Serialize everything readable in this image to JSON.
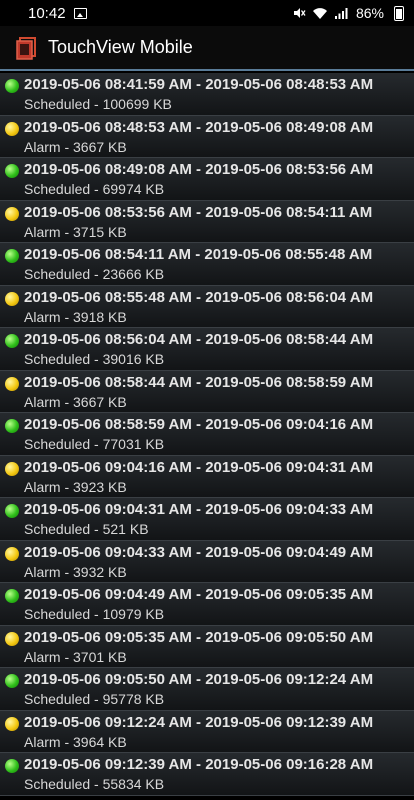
{
  "status_bar": {
    "time": "10:42",
    "battery": "86%"
  },
  "app_bar": {
    "title": "TouchView Mobile",
    "logo_icon": "touchview-logo"
  },
  "recordings": [
    {
      "range": "2019-05-06 08:41:59 AM - 2019-05-06 08:48:53 AM",
      "detail": "Scheduled - 100699 KB",
      "status": "green"
    },
    {
      "range": "2019-05-06 08:48:53 AM - 2019-05-06 08:49:08 AM",
      "detail": "Alarm - 3667 KB",
      "status": "yellow"
    },
    {
      "range": "2019-05-06 08:49:08 AM - 2019-05-06 08:53:56 AM",
      "detail": "Scheduled - 69974 KB",
      "status": "green"
    },
    {
      "range": "2019-05-06 08:53:56 AM - 2019-05-06 08:54:11 AM",
      "detail": "Alarm - 3715 KB",
      "status": "yellow"
    },
    {
      "range": "2019-05-06 08:54:11 AM - 2019-05-06 08:55:48 AM",
      "detail": "Scheduled - 23666 KB",
      "status": "green"
    },
    {
      "range": "2019-05-06 08:55:48 AM - 2019-05-06 08:56:04 AM",
      "detail": "Alarm - 3918 KB",
      "status": "yellow"
    },
    {
      "range": "2019-05-06 08:56:04 AM - 2019-05-06 08:58:44 AM",
      "detail": "Scheduled - 39016 KB",
      "status": "green"
    },
    {
      "range": "2019-05-06 08:58:44 AM - 2019-05-06 08:58:59 AM",
      "detail": "Alarm - 3667 KB",
      "status": "yellow"
    },
    {
      "range": "2019-05-06 08:58:59 AM - 2019-05-06 09:04:16 AM",
      "detail": "Scheduled - 77031 KB",
      "status": "green"
    },
    {
      "range": "2019-05-06 09:04:16 AM - 2019-05-06 09:04:31 AM",
      "detail": "Alarm - 3923 KB",
      "status": "yellow"
    },
    {
      "range": "2019-05-06 09:04:31 AM - 2019-05-06 09:04:33 AM",
      "detail": "Scheduled - 521 KB",
      "status": "green"
    },
    {
      "range": "2019-05-06 09:04:33 AM - 2019-05-06 09:04:49 AM",
      "detail": "Alarm - 3932 KB",
      "status": "yellow"
    },
    {
      "range": "2019-05-06 09:04:49 AM - 2019-05-06 09:05:35 AM",
      "detail": "Scheduled - 10979 KB",
      "status": "green"
    },
    {
      "range": "2019-05-06 09:05:35 AM - 2019-05-06 09:05:50 AM",
      "detail": "Alarm - 3701 KB",
      "status": "yellow"
    },
    {
      "range": "2019-05-06 09:05:50 AM - 2019-05-06 09:12:24 AM",
      "detail": "Scheduled - 95778 KB",
      "status": "green"
    },
    {
      "range": "2019-05-06 09:12:24 AM - 2019-05-06 09:12:39 AM",
      "detail": "Alarm - 3964 KB",
      "status": "yellow"
    },
    {
      "range": "2019-05-06 09:12:39 AM - 2019-05-06 09:16:28 AM",
      "detail": "Scheduled - 55834 KB",
      "status": "green"
    }
  ]
}
